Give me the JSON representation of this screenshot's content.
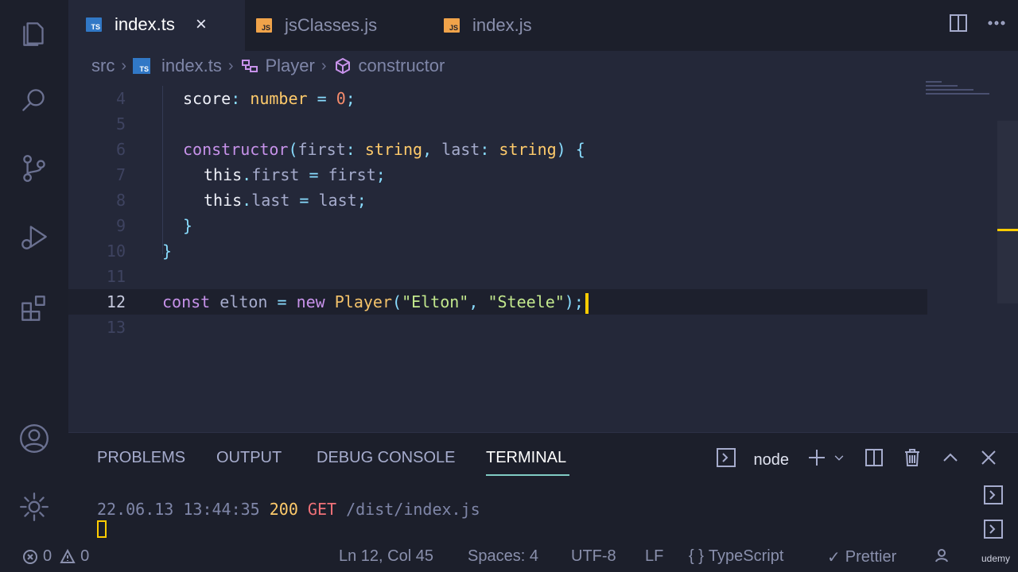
{
  "tabs": [
    {
      "label": "index.ts",
      "badge": "TS",
      "active": true,
      "close": "×"
    },
    {
      "label": "jsClasses.js",
      "badge": "JS",
      "active": false
    },
    {
      "label": "index.js",
      "badge": "JS",
      "active": false
    }
  ],
  "breadcrumb": {
    "folder": "src",
    "file": "index.ts",
    "file_badge": "TS",
    "class": "Player",
    "method": "constructor"
  },
  "editor": {
    "lines": [
      {
        "num": "4",
        "tokens": [
          {
            "t": "score",
            "c": "prop"
          },
          {
            "t": ": ",
            "c": "punc"
          },
          {
            "t": "number",
            "c": "type"
          },
          {
            "t": " = ",
            "c": "punc"
          },
          {
            "t": "0",
            "c": "num"
          },
          {
            "t": ";",
            "c": "punc"
          }
        ],
        "indent": 1
      },
      {
        "num": "5",
        "tokens": [],
        "indent": 0
      },
      {
        "num": "6",
        "tokens": [
          {
            "t": "constructor",
            "c": "kw"
          },
          {
            "t": "(",
            "c": "punc"
          },
          {
            "t": "first",
            "c": "plain"
          },
          {
            "t": ": ",
            "c": "punc"
          },
          {
            "t": "string",
            "c": "type"
          },
          {
            "t": ", ",
            "c": "punc"
          },
          {
            "t": "last",
            "c": "plain"
          },
          {
            "t": ": ",
            "c": "punc"
          },
          {
            "t": "string",
            "c": "type"
          },
          {
            "t": ") {",
            "c": "punc"
          }
        ],
        "indent": 1
      },
      {
        "num": "7",
        "tokens": [
          {
            "t": "this",
            "c": "prop"
          },
          {
            "t": ".",
            "c": "punc"
          },
          {
            "t": "first",
            "c": "plain"
          },
          {
            "t": " = ",
            "c": "punc"
          },
          {
            "t": "first",
            "c": "plain"
          },
          {
            "t": ";",
            "c": "punc"
          }
        ],
        "indent": 2
      },
      {
        "num": "8",
        "tokens": [
          {
            "t": "this",
            "c": "prop"
          },
          {
            "t": ".",
            "c": "punc"
          },
          {
            "t": "last",
            "c": "plain"
          },
          {
            "t": " = ",
            "c": "punc"
          },
          {
            "t": "last",
            "c": "plain"
          },
          {
            "t": ";",
            "c": "punc"
          }
        ],
        "indent": 2
      },
      {
        "num": "9",
        "tokens": [
          {
            "t": "}",
            "c": "punc"
          }
        ],
        "indent": 1
      },
      {
        "num": "10",
        "tokens": [
          {
            "t": "}",
            "c": "punc"
          }
        ],
        "indent": 0
      },
      {
        "num": "11",
        "tokens": [],
        "indent": 0
      },
      {
        "num": "12",
        "tokens": [
          {
            "t": "const ",
            "c": "kw"
          },
          {
            "t": "elton",
            "c": "plain"
          },
          {
            "t": " = ",
            "c": "punc"
          },
          {
            "t": "new ",
            "c": "kw"
          },
          {
            "t": "Player",
            "c": "fn"
          },
          {
            "t": "(",
            "c": "punc"
          },
          {
            "t": "\"Elton\"",
            "c": "str"
          },
          {
            "t": ", ",
            "c": "punc"
          },
          {
            "t": "\"Steele\"",
            "c": "str"
          },
          {
            "t": ");",
            "c": "punc"
          }
        ],
        "indent": 0,
        "current": true
      },
      {
        "num": "13",
        "tokens": [],
        "indent": 0
      }
    ]
  },
  "panel": {
    "tabs": [
      "PROBLEMS",
      "OUTPUT",
      "DEBUG CONSOLE",
      "TERMINAL"
    ],
    "active_tab": "TERMINAL",
    "terminal_name": "node",
    "log": {
      "timestamp": "22.06.13 13:44:35",
      "status": "200",
      "method": "GET",
      "path": "/dist/index.js"
    }
  },
  "statusbar": {
    "errors": "0",
    "warnings": "0",
    "position": "Ln 12, Col 45",
    "spaces": "Spaces: 4",
    "encoding": "UTF-8",
    "eol": "LF",
    "language": "TypeScript",
    "formatter": "Prettier",
    "watermark": "udemy"
  },
  "colors": {
    "accent": "#ffcc00",
    "ts_badge": "#3178c6",
    "js_badge": "#f0a34a"
  }
}
